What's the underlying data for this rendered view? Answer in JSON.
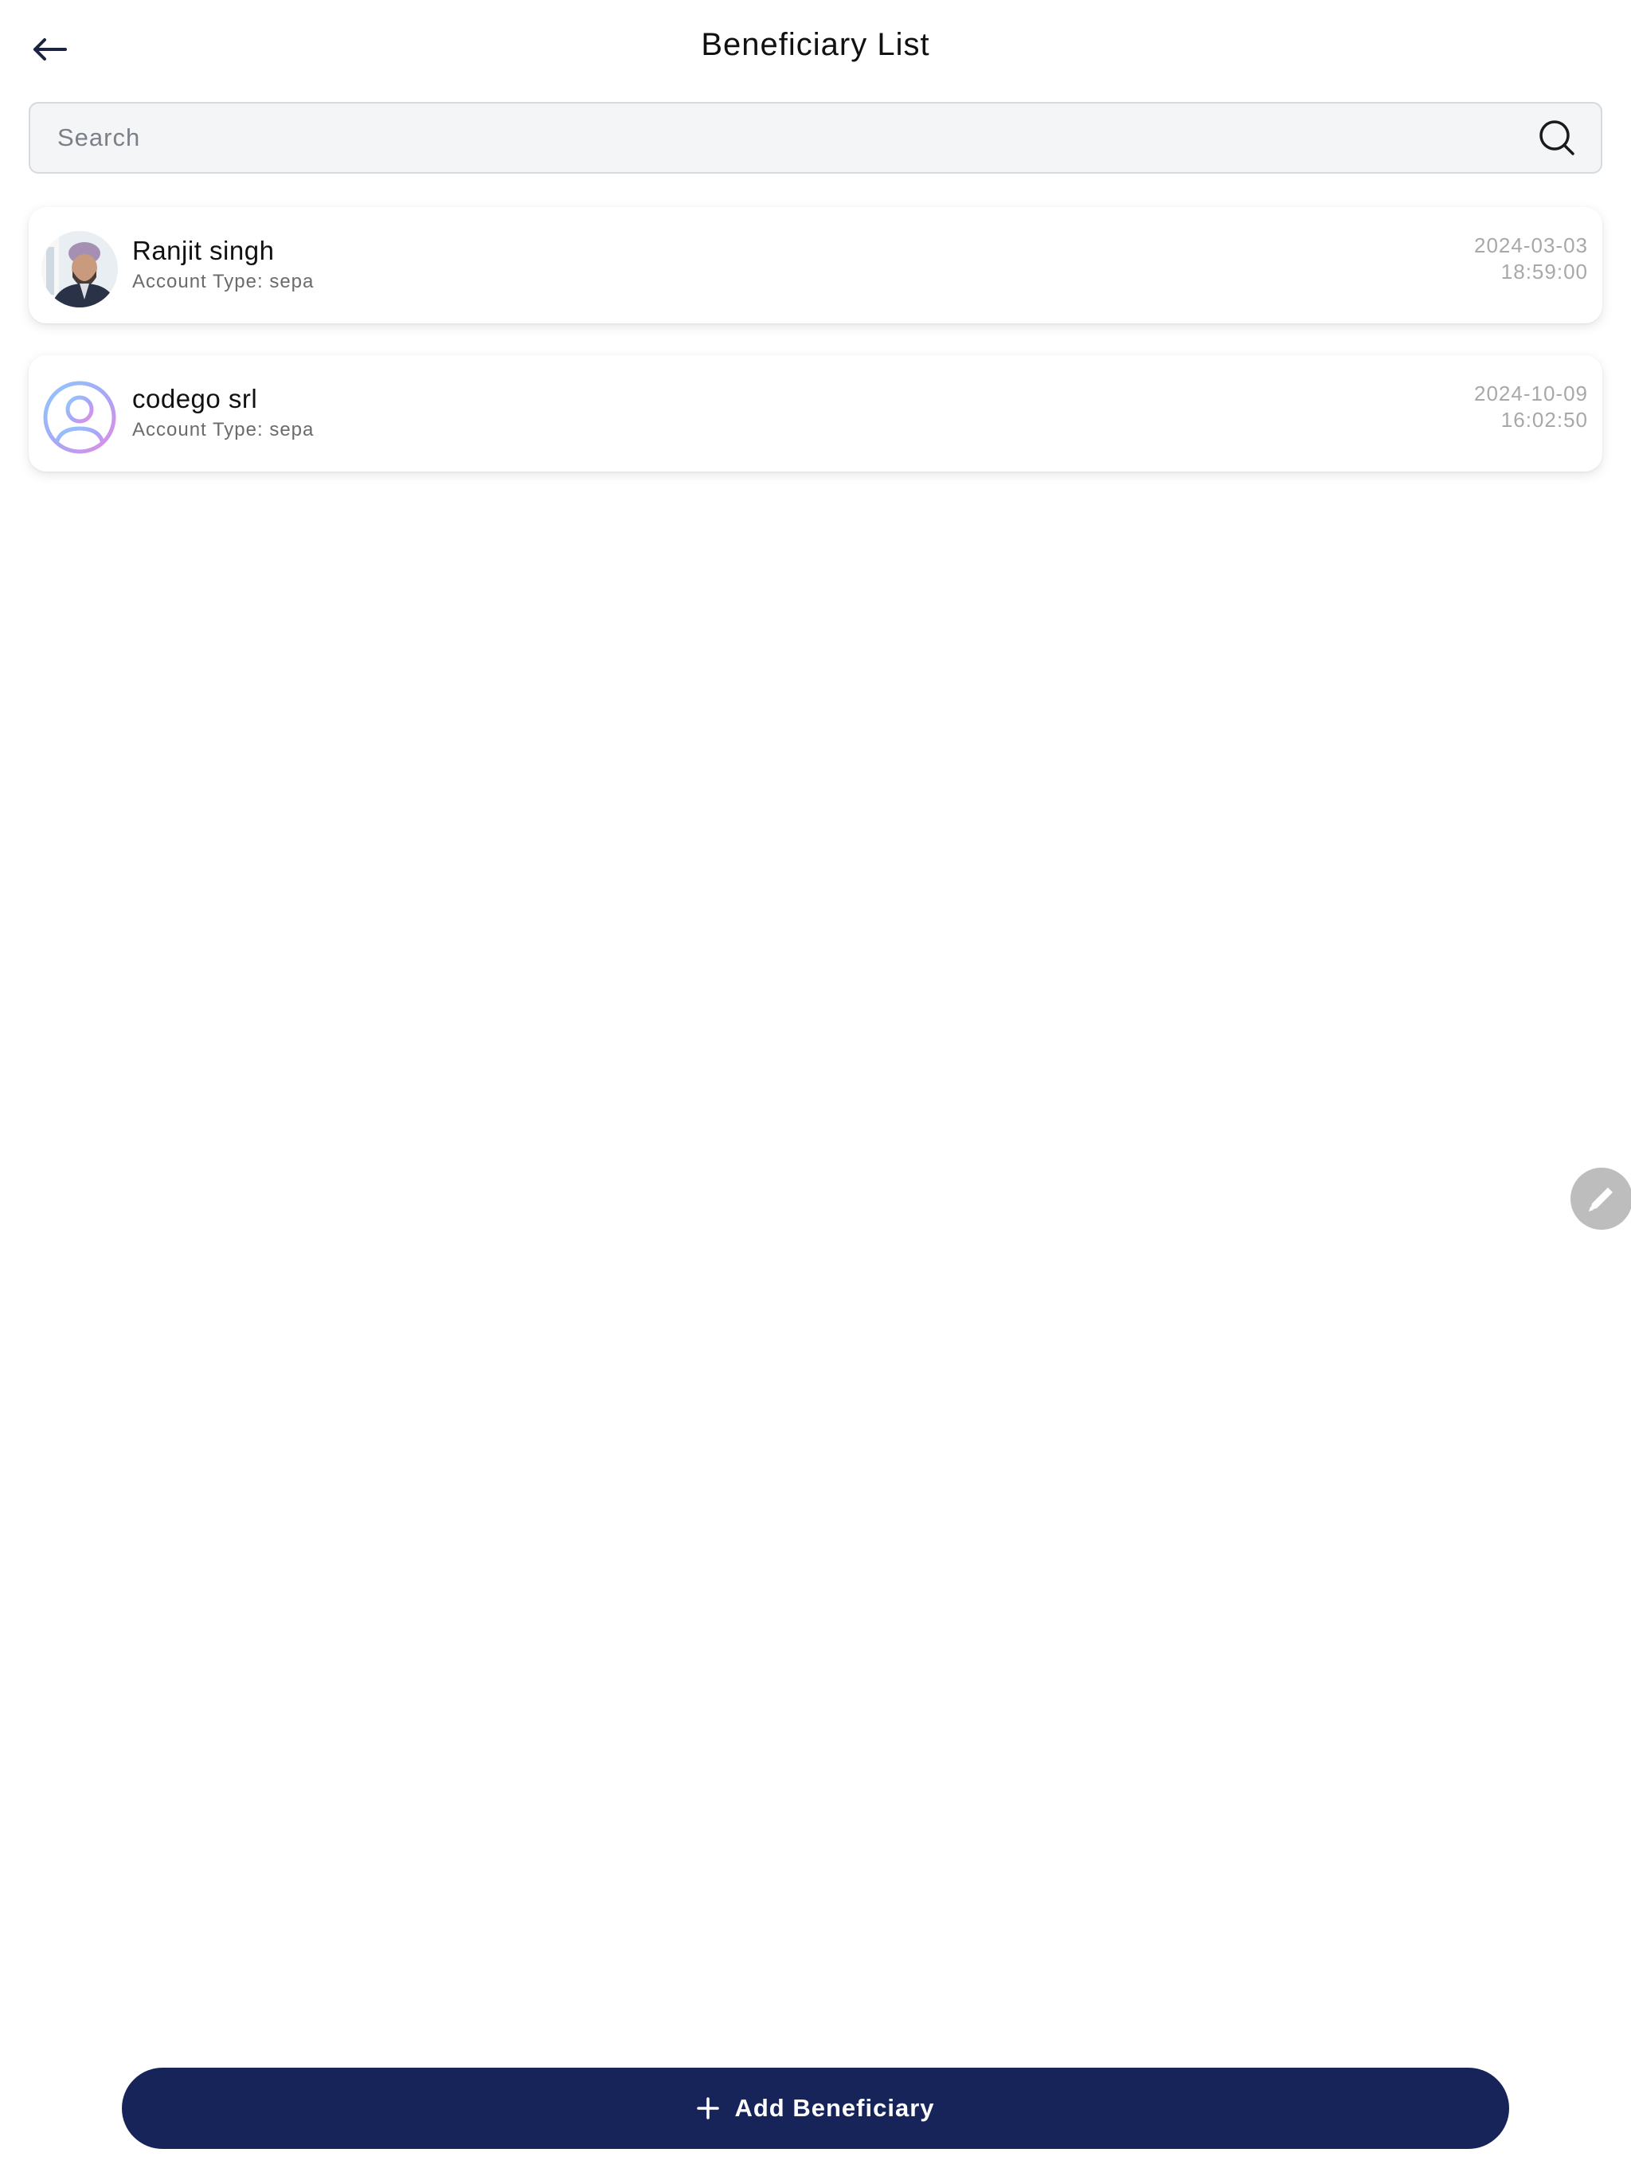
{
  "header": {
    "title": "Beneficiary List",
    "back_icon": "arrow-left-icon"
  },
  "search": {
    "placeholder": "Search",
    "value": "",
    "icon": "search-icon"
  },
  "beneficiaries": [
    {
      "name": "Ranjit singh",
      "account_type": "Account Type: sepa",
      "date": "2024-03-03",
      "time": "18:59:00",
      "avatar": "profile-photo"
    },
    {
      "name": "codego srl",
      "account_type": "Account Type: sepa",
      "date": "2024-10-09",
      "time": "16:02:50",
      "avatar": "default-user-icon"
    }
  ],
  "fab": {
    "icon": "pencil-icon"
  },
  "footer": {
    "add_label": "Add Beneficiary",
    "add_icon": "plus-icon"
  },
  "colors": {
    "primary": "#16245a",
    "date_text": "#a8a8a8",
    "search_bg": "#f4f5f7",
    "fab_bg": "#bdbdbd"
  }
}
